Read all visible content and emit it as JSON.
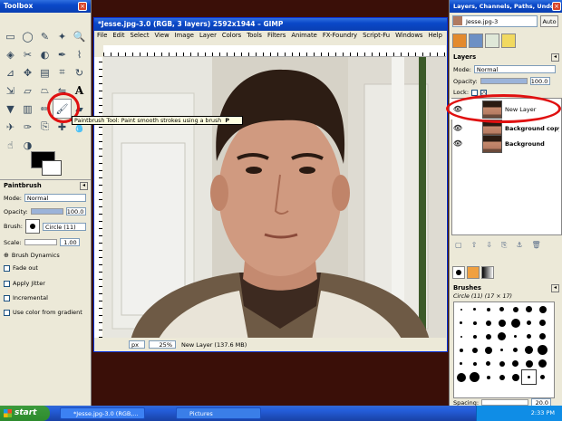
{
  "toolbox": {
    "title": "Toolbox",
    "tooltip": "Paintbrush Tool: Paint smooth strokes using a brush",
    "tooltip_key": "P",
    "options_title": "Paintbrush",
    "mode_label": "Mode:",
    "mode_value": "Normal",
    "opacity_label": "Opacity:",
    "opacity_value": "100.0",
    "brush_label": "Brush:",
    "brush_value": "Circle (11)",
    "scale_label": "Scale:",
    "scale_value": "1.00",
    "brush_dynamics": "Brush Dynamics",
    "fade_out": "Fade out",
    "apply_jitter": "Apply Jitter",
    "incremental": "Incremental",
    "use_color_gradient": "Use color from gradient"
  },
  "image_window": {
    "title": "*Jesse.jpg-3.0 (RGB, 3 layers) 2592x1944 – GIMP",
    "menu": [
      "File",
      "Edit",
      "Select",
      "View",
      "Image",
      "Layer",
      "Colors",
      "Tools",
      "Filters",
      "Animate",
      "FX-Foundry",
      "Script-Fu",
      "Windows",
      "Help"
    ],
    "unit": "px",
    "zoom": "25%",
    "status": "New Layer (137.6 MB)"
  },
  "dock": {
    "title": "Layers, Channels, Paths, Undo –",
    "image_name": "Jesse.jpg-3",
    "auto_label": "Auto",
    "layers_heading": "Layers",
    "mode_label": "Mode:",
    "mode_value": "Normal",
    "opacity_label": "Opacity:",
    "opacity_value": "100.0",
    "lock_label": "Lock:",
    "layers": [
      "New Layer",
      "Background copy",
      "Background"
    ],
    "brushes_heading": "Brushes",
    "brush_info": "Circle (11) (17 × 17)",
    "spacing_label": "Spacing:",
    "spacing_value": "20.0"
  },
  "taskbar": {
    "start": "start",
    "tasks": [
      "*Jesse.jpg-3.0 (RGB,...",
      "Pictures"
    ],
    "clock": "2:33 PM"
  },
  "colors": {
    "highlight_circle": "#e01010",
    "titlebar": "#0a48c8"
  }
}
